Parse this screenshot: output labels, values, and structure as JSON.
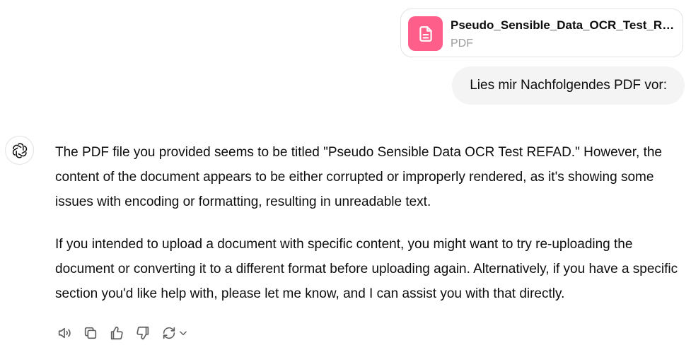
{
  "attachment": {
    "file_name": "Pseudo_Sensible_Data_OCR_Test_REFAD.pdf",
    "file_type": "PDF",
    "icon": "document-icon",
    "icon_bg_color": "#fd5e8a"
  },
  "user_message": {
    "text": "Lies mir Nachfolgendes PDF vor:"
  },
  "assistant": {
    "avatar_icon": "openai-logo-icon",
    "paragraphs": [
      "The PDF file you provided seems to be titled \"Pseudo Sensible Data OCR Test REFAD.\" However, the content of the document appears to be either corrupted or improperly rendered, as it's showing some issues with encoding or formatting, resulting in unreadable text.",
      "If you intended to upload a document with specific content, you might want to try re-uploading the document or converting it to a different format before uploading again. Alternatively, if you have a specific section you'd like help with, please let me know, and I can assist you with that directly."
    ]
  },
  "actions": [
    {
      "name": "read-aloud",
      "icon": "speaker-icon"
    },
    {
      "name": "copy",
      "icon": "copy-icon"
    },
    {
      "name": "good-response",
      "icon": "thumbs-up-icon"
    },
    {
      "name": "bad-response",
      "icon": "thumbs-down-icon"
    },
    {
      "name": "regenerate",
      "icon": "refresh-icon"
    }
  ],
  "colors": {
    "bubble_bg": "#f4f4f4",
    "icon_gray": "#5d5d5d",
    "muted_text": "#9b9b9b"
  }
}
